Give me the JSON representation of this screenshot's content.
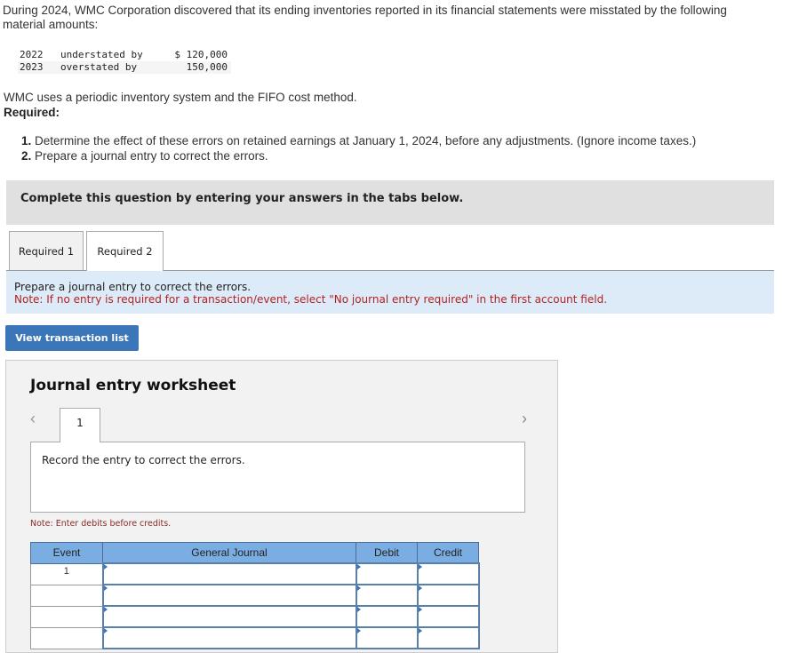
{
  "problem": {
    "intro": "During 2024, WMC Corporation discovered that its ending inventories reported in its financial statements were misstated by the following material amounts:",
    "misstatements": [
      {
        "year": "2022",
        "description": "understated by",
        "amount": "$ 120,000"
      },
      {
        "year": "2023",
        "description": "overstated by",
        "amount": "150,000"
      }
    ],
    "method_text": "WMC uses a periodic inventory system and the FIFO cost method.",
    "required_heading": "Required:",
    "requirements": [
      {
        "num": "1.",
        "text": "Determine the effect of these errors on retained earnings at January 1, 2024, before any adjustments. (Ignore income taxes.)"
      },
      {
        "num": "2.",
        "text": "Prepare a journal entry to correct the errors."
      }
    ]
  },
  "complete_banner": "Complete this question by entering your answers in the tabs below.",
  "tabs": [
    {
      "label": "Required 1",
      "active": false
    },
    {
      "label": "Required 2",
      "active": true
    }
  ],
  "instructions": {
    "line1": "Prepare a journal entry to correct the errors.",
    "note": "Note: If no entry is required for a transaction/event, select \"No journal entry required\" in the first account field."
  },
  "view_transaction_list_label": "View transaction list",
  "worksheet": {
    "title": "Journal entry worksheet",
    "prev_icon": "‹",
    "next_icon": "›",
    "current_page": "1",
    "record_text": "Record the entry to correct the errors.",
    "debit_note": "Note: Enter debits before credits.",
    "columns": [
      "Event",
      "General Journal",
      "Debit",
      "Credit"
    ],
    "rows": [
      {
        "event": "1",
        "account": "",
        "debit": "",
        "credit": ""
      },
      {
        "event": "",
        "account": "",
        "debit": "",
        "credit": ""
      },
      {
        "event": "",
        "account": "",
        "debit": "",
        "credit": ""
      },
      {
        "event": "",
        "account": "",
        "debit": "",
        "credit": ""
      }
    ]
  }
}
